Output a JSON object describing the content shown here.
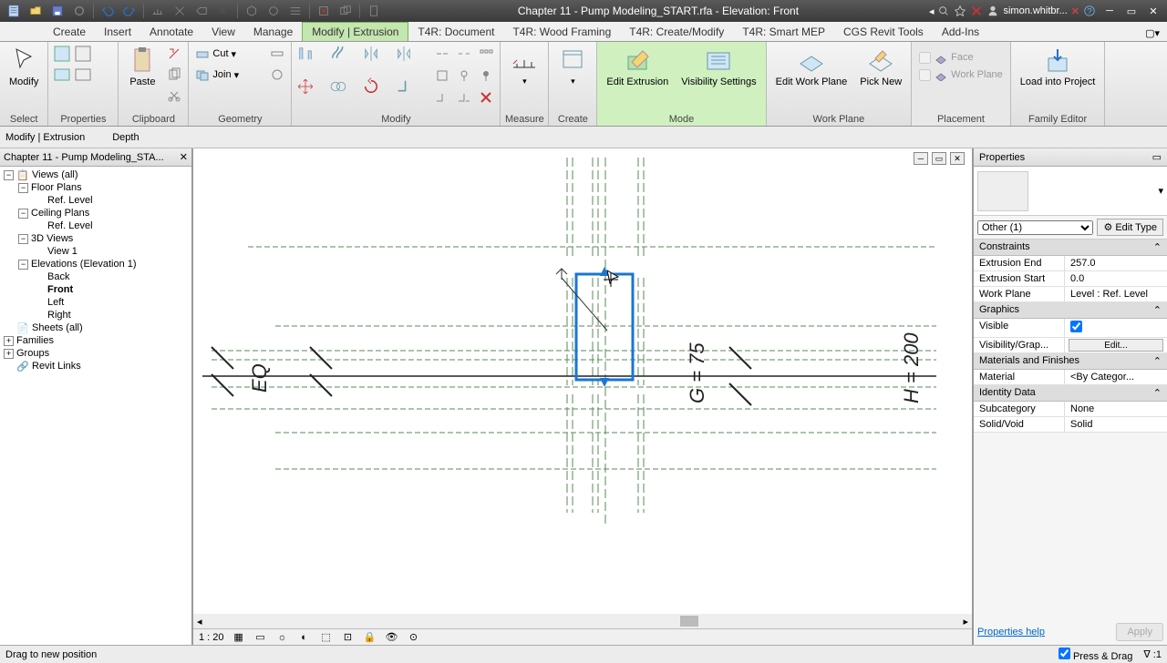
{
  "title": "Chapter 11 - Pump Modeling_START.rfa - Elevation: Front",
  "user": "simon.whitbr...",
  "tabs": [
    "Create",
    "Insert",
    "Annotate",
    "View",
    "Manage",
    "Modify | Extrusion",
    "T4R: Document",
    "T4R: Wood Framing",
    "T4R: Create/Modify",
    "T4R: Smart MEP",
    "CGS Revit Tools",
    "Add-Ins"
  ],
  "active_tab": "Modify | Extrusion",
  "panels": {
    "select": "Select",
    "properties": "Properties",
    "clipboard": "Clipboard",
    "geometry": "Geometry",
    "modify": "Modify",
    "measure": "Measure",
    "create": "Create",
    "mode": "Mode",
    "work_plane": "Work Plane",
    "placement": "Placement",
    "family_editor": "Family Editor"
  },
  "buttons": {
    "modify": "Modify",
    "paste": "Paste",
    "cut": "Cut",
    "join": "Join",
    "edit_extrusion": "Edit Extrusion",
    "visibility_settings": "Visibility Settings",
    "edit_work_plane": "Edit Work Plane",
    "pick_new": "Pick New",
    "face": "Face",
    "work_plane": "Work Plane",
    "load_into_project": "Load into Project"
  },
  "options_bar": {
    "context": "Modify | Extrusion",
    "depth_label": "Depth"
  },
  "browser": {
    "title": "Chapter 11 - Pump Modeling_STA...",
    "views": "Views (all)",
    "floor_plans": "Floor Plans",
    "ref_level": "Ref. Level",
    "ceiling_plans": "Ceiling Plans",
    "threed": "3D Views",
    "view1": "View 1",
    "elevations": "Elevations (Elevation 1)",
    "back": "Back",
    "front": "Front",
    "left": "Left",
    "right": "Right",
    "sheets": "Sheets (all)",
    "families": "Families",
    "groups": "Groups",
    "revit_links": "Revit Links"
  },
  "scale": "1 : 20",
  "props": {
    "title": "Properties",
    "type_selector": "Other (1)",
    "edit_type": "Edit Type",
    "groups": {
      "constraints": "Constraints",
      "graphics": "Graphics",
      "materials": "Materials and Finishes",
      "identity": "Identity Data"
    },
    "rows": {
      "extrusion_end": {
        "k": "Extrusion End",
        "v": "257.0"
      },
      "extrusion_start": {
        "k": "Extrusion Start",
        "v": "0.0"
      },
      "work_plane": {
        "k": "Work Plane",
        "v": "Level : Ref. Level"
      },
      "visible": {
        "k": "Visible",
        "v": true
      },
      "vis_graphics": {
        "k": "Visibility/Grap...",
        "v": "Edit..."
      },
      "material": {
        "k": "Material",
        "v": "<By Categor..."
      },
      "subcategory": {
        "k": "Subcategory",
        "v": "None"
      },
      "solid_void": {
        "k": "Solid/Void",
        "v": "Solid"
      }
    },
    "help": "Properties help",
    "apply": "Apply"
  },
  "status": {
    "left": "Drag to new position",
    "press_drag": "Press & Drag",
    "filter_count": "1"
  },
  "canvas": {
    "dim_g": "G = 75",
    "dim_h": "H = 200",
    "dim_eq": "EQ"
  }
}
